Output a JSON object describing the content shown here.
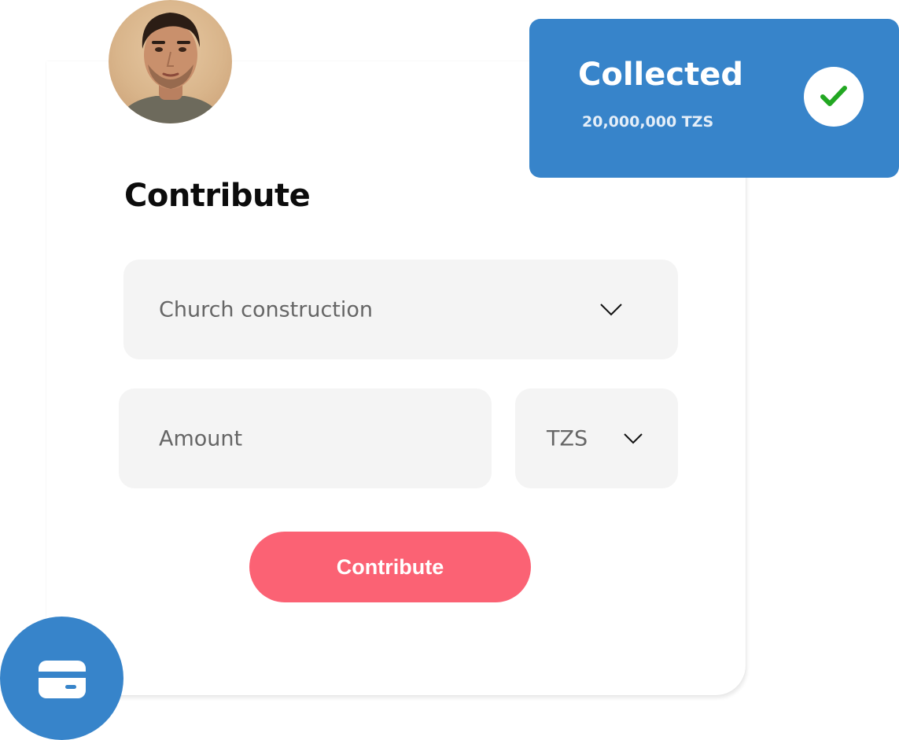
{
  "form": {
    "title": "Contribute",
    "campaign_value": "Church construction",
    "amount_placeholder": "Amount",
    "currency_value": "TZS",
    "submit_label": "Contribute"
  },
  "collected": {
    "title": "Collected",
    "amount": "20,000,000 TZS"
  },
  "icons": {
    "campaign_dropdown": "chevron-down-icon",
    "currency_dropdown": "chevron-down-icon",
    "collected_status": "checkmark-icon",
    "payment": "credit-card-icon"
  },
  "colors": {
    "accent_blue": "#3784ca",
    "button_pink": "#fb6274",
    "check_green": "#22a722",
    "field_bg": "#f4f4f4"
  }
}
